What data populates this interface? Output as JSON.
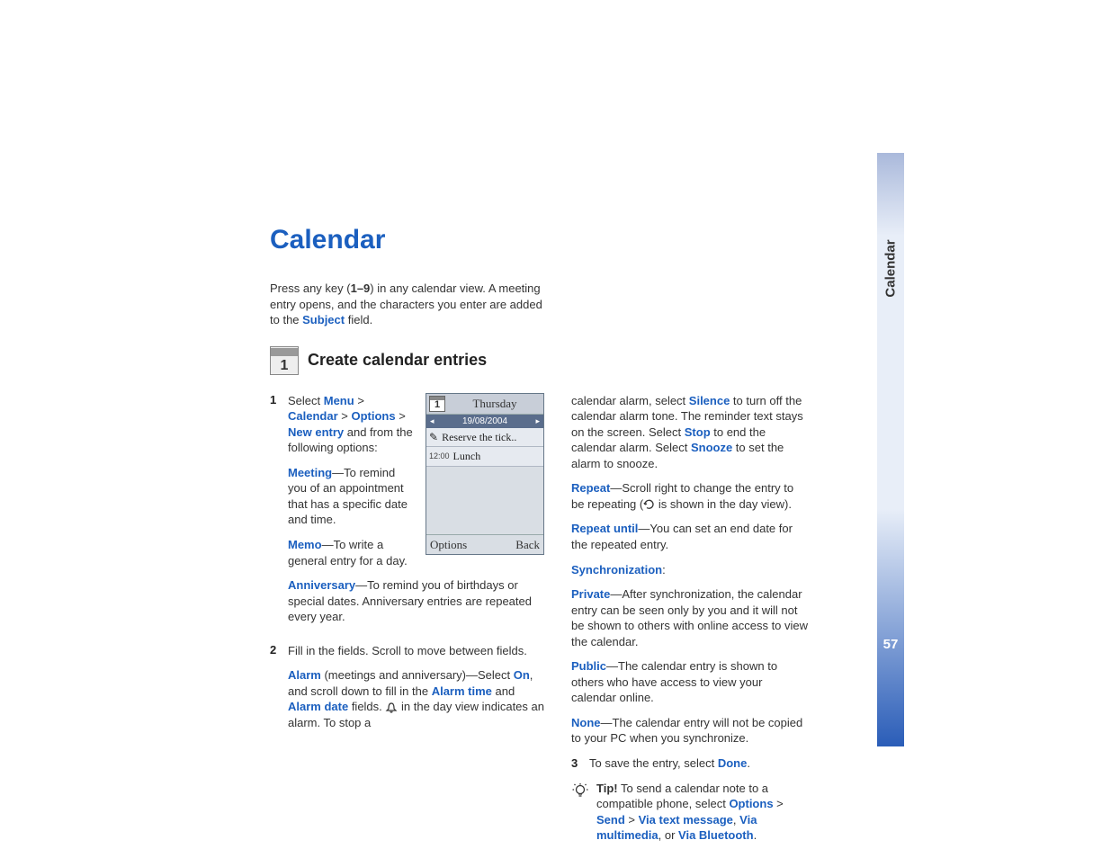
{
  "sidebar": {
    "label": "Calendar",
    "page": "57"
  },
  "title": "Calendar",
  "intro": {
    "pre": "Press any key (",
    "keys": "1–9",
    "mid": ") in any calendar view. A meeting entry opens, and the characters you enter are added to the ",
    "subject": "Subject",
    "post": " field."
  },
  "section_title": "Create calendar entries",
  "steps": {
    "s1": {
      "num": "1",
      "select": "Select ",
      "menu": "Menu",
      "gt1": " > ",
      "calendar": "Calendar",
      "gt2": " > ",
      "options": "Options",
      "gt3": " > ",
      "newentry": "New entry",
      "tail": " and from the following options:",
      "meeting_label": "Meeting",
      "meeting_text": "—To remind you of an appointment that has a specific date and time.",
      "memo_label": "Memo",
      "memo_text": "—To write a general entry for a day.",
      "anniv_label": "Anniversary",
      "anniv_text": "—To remind you of birthdays or special dates. Anniversary entries are repeated every year."
    },
    "s2": {
      "num": "2",
      "intro": "Fill in the fields. Scroll to move between fields.",
      "alarm_label": "Alarm",
      "alarm_mid1": " (meetings and anniversary)—Select ",
      "on": "On",
      "alarm_mid2": ", and scroll down to fill in the ",
      "alarm_time": "Alarm time",
      "and": " and ",
      "alarm_date": "Alarm date",
      "alarm_mid3": " fields. ",
      "alarm_mid4": " in the day view indicates an alarm. To stop a "
    }
  },
  "phone": {
    "icon_num": "1",
    "day": "Thursday",
    "date": "19/08/2004",
    "arrow_l": "◂",
    "arrow_r": "▸",
    "row1": "Reserve the tick..",
    "row2_time": "12:00",
    "row2_text": "Lunch",
    "left_soft": "Options",
    "right_soft": "Back"
  },
  "right": {
    "cont1_a": "calendar alarm, select ",
    "silence": "Silence",
    "cont1_b": " to turn off the calendar alarm tone. The reminder text stays on the screen. Select ",
    "stop": "Stop",
    "cont1_c": " to end the calendar alarm. Select ",
    "snooze": "Snooze",
    "cont1_d": " to set the alarm to snooze.",
    "repeat_label": "Repeat",
    "repeat_text_a": "—Scroll right to change the entry to be repeating (",
    "repeat_text_b": " is shown in the day view).",
    "repeat_until_label": "Repeat until",
    "repeat_until_text": "—You can set an end date for the repeated entry.",
    "sync_label": "Synchronization",
    "sync_colon": ":",
    "private_label": "Private",
    "private_text": "—After synchronization, the calendar entry can be seen only by you and it will not be shown to others with online access to view the calendar.",
    "public_label": "Public",
    "public_text": "—The calendar entry is shown to others who have access to view your calendar online.",
    "none_label": "None",
    "none_text": "—The calendar entry will not be copied to your PC when you synchronize.",
    "s3_num": "3",
    "s3_a": "To save the entry, select ",
    "done": "Done",
    "s3_b": ".",
    "tip_bold": "Tip!",
    "tip_a": " To send a calendar note to a compatible phone, select ",
    "tip_options": "Options",
    "tip_gt1": " > ",
    "tip_send": "Send",
    "tip_gt2": " > ",
    "tip_via_text": "Via text message",
    "tip_comma": ", ",
    "tip_via_mm": "Via multimedia",
    "tip_or": ", or ",
    "tip_via_bt": "Via Bluetooth",
    "tip_end": "."
  }
}
